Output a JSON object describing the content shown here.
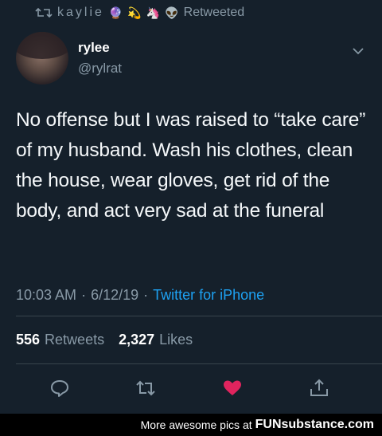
{
  "retweet": {
    "user": "kaylie",
    "emojis": [
      "🔮",
      "💫",
      "🦄",
      "👽"
    ],
    "label": "Retweeted"
  },
  "author": {
    "name": "rylee",
    "handle": "@rylrat"
  },
  "tweet": {
    "text": "No offense but I was raised to “take care” of my husband. Wash his clothes, clean the house, wear gloves, get rid of the body, and act very sad at the funeral"
  },
  "meta": {
    "time": "10:03 AM",
    "date": "6/12/19",
    "separator": "·",
    "source": "Twitter for iPhone"
  },
  "stats": {
    "retweets_count": "556",
    "retweets_label": "Retweets",
    "likes_count": "2,327",
    "likes_label": "Likes"
  },
  "actions": {
    "reply_icon": "reply-icon",
    "retweet_icon": "retweet-icon",
    "like_icon": "heart-icon",
    "share_icon": "share-icon",
    "liked_color": "#e0245e"
  },
  "footer": {
    "text": "More awesome pics at",
    "brand": "FUNsubstance.com"
  }
}
